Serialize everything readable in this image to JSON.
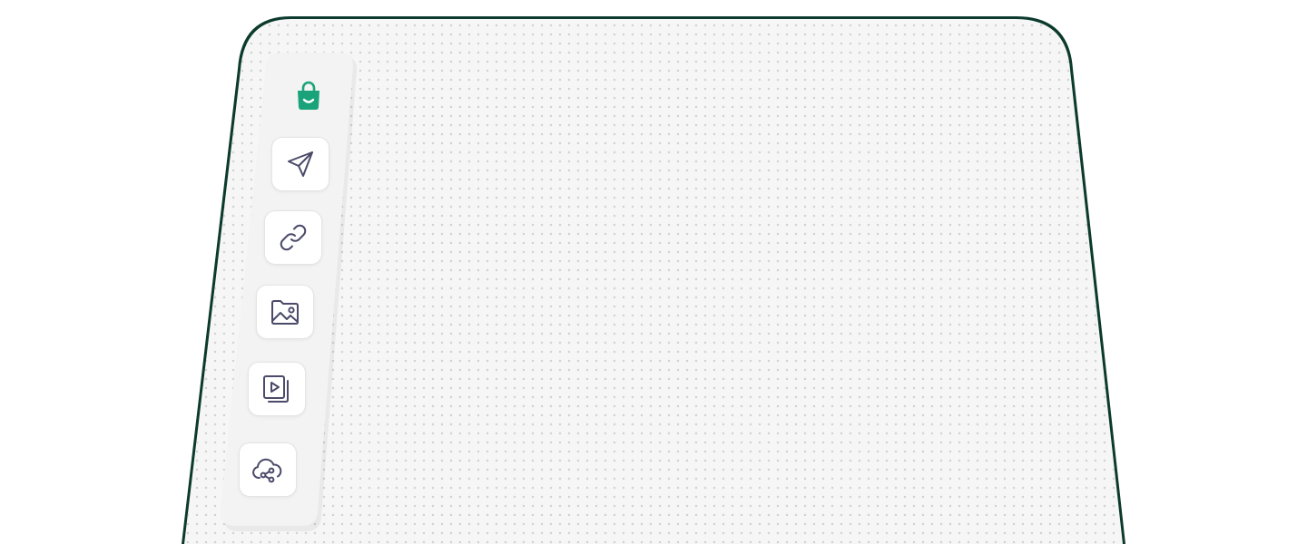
{
  "board": {
    "border_color": "#0c3b2e",
    "surface_color": "#f6f6f6",
    "dot_color": "#d2d2d2"
  },
  "toolbar": {
    "logo": {
      "icon": "shopping-bag-icon",
      "color": "#1aa37a"
    },
    "tools": [
      {
        "name": "send",
        "icon": "paper-plane-icon"
      },
      {
        "name": "link",
        "icon": "link-icon"
      },
      {
        "name": "image",
        "icon": "image-folder-icon"
      },
      {
        "name": "video",
        "icon": "video-gallery-icon"
      },
      {
        "name": "cloud-share",
        "icon": "cloud-share-icon"
      }
    ],
    "icon_color": "#4a4a6a"
  }
}
